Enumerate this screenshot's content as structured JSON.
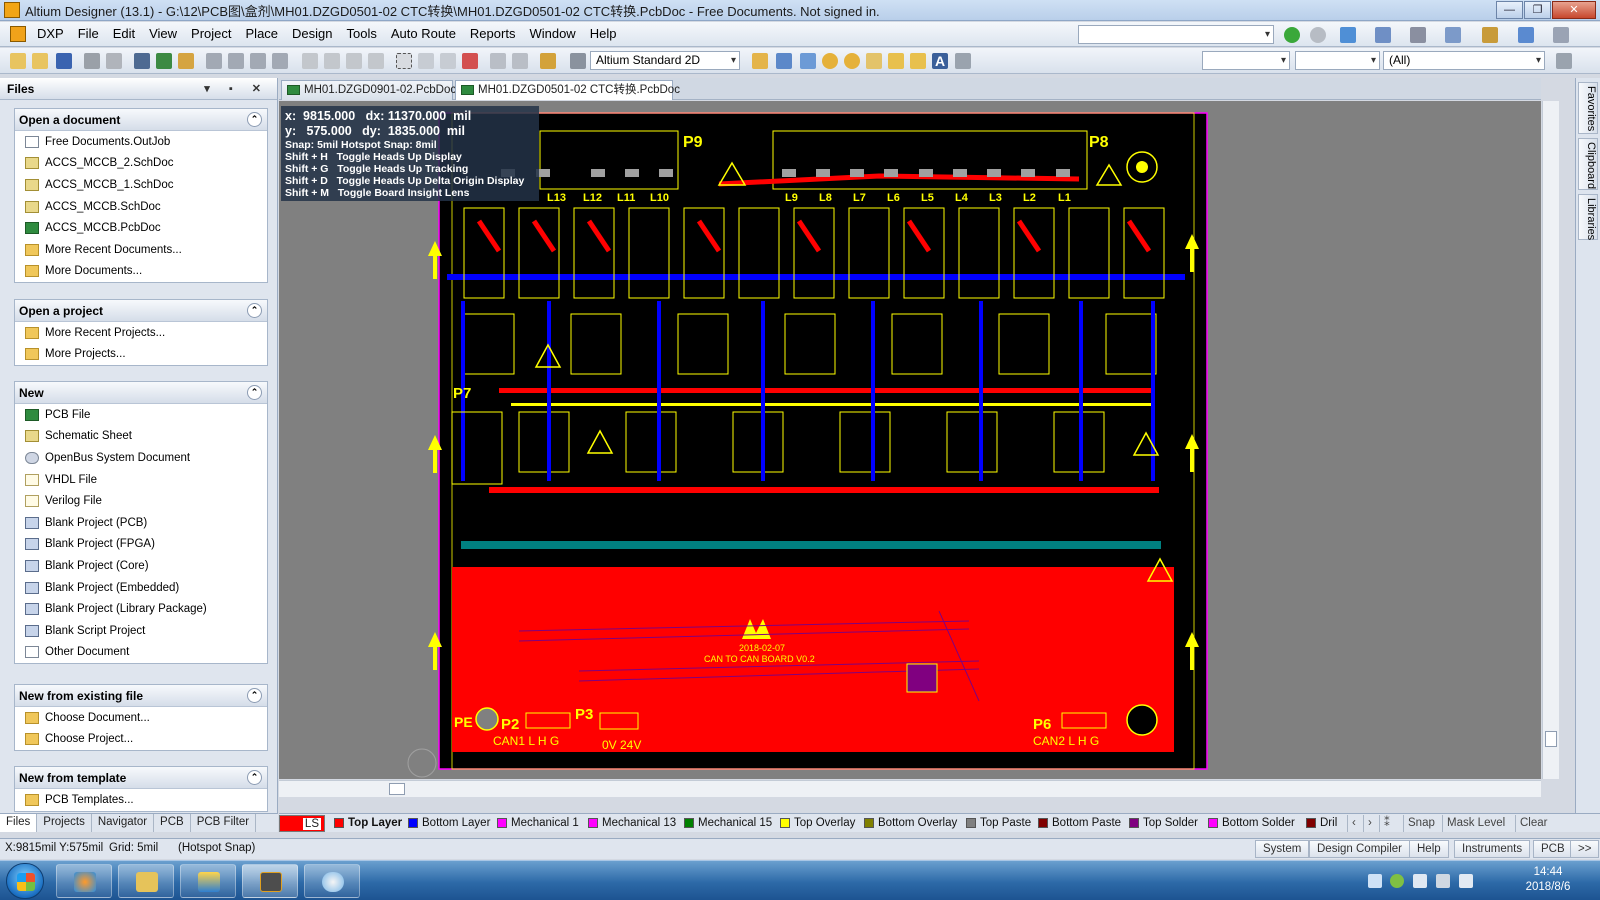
{
  "window": {
    "title": "Altium Designer (13.1) - G:\\12\\PCB图\\盒剂\\MH01.DZGD0501-02 CTC转换\\MH01.DZGD0501-02 CTC转换.PcbDoc - Free Documents. Not signed in.",
    "minimize": "0",
    "maximize": "1",
    "close": "r"
  },
  "menu": {
    "items": [
      "DXP",
      "File",
      "Edit",
      "View",
      "Project",
      "Place",
      "Design",
      "Tools",
      "Auto Route",
      "Reports",
      "Window",
      "Help"
    ]
  },
  "toolbar": {
    "view_mode": "Altium Standard 2D",
    "filter": "(All)"
  },
  "files_panel": {
    "title": "Files",
    "sections": [
      {
        "title": "Open a document",
        "items": [
          {
            "label": "Free Documents.OutJob",
            "icon": "doc"
          },
          {
            "label": "ACCS_MCCB_2.SchDoc",
            "icon": "sch"
          },
          {
            "label": "ACCS_MCCB_1.SchDoc",
            "icon": "sch"
          },
          {
            "label": "ACCS_MCCB.SchDoc",
            "icon": "sch"
          },
          {
            "label": "ACCS_MCCB.PcbDoc",
            "icon": "pcb"
          },
          {
            "label": "More Recent Documents...",
            "icon": "folder"
          },
          {
            "label": "More Documents...",
            "icon": "folder"
          }
        ]
      },
      {
        "title": "Open a project",
        "items": [
          {
            "label": "More Recent Projects...",
            "icon": "folder"
          },
          {
            "label": "More Projects...",
            "icon": "folder"
          }
        ]
      },
      {
        "title": "New",
        "items": [
          {
            "label": "PCB File",
            "icon": "pcb"
          },
          {
            "label": "Schematic Sheet",
            "icon": "sch"
          },
          {
            "label": "OpenBus System Document",
            "icon": "bus"
          },
          {
            "label": "VHDL File",
            "icon": "hdl"
          },
          {
            "label": "Verilog File",
            "icon": "hdl"
          },
          {
            "label": "Blank Project (PCB)",
            "icon": "prj"
          },
          {
            "label": "Blank Project (FPGA)",
            "icon": "prj"
          },
          {
            "label": "Blank Project (Core)",
            "icon": "prj"
          },
          {
            "label": "Blank Project (Embedded)",
            "icon": "prj"
          },
          {
            "label": "Blank Project (Library Package)",
            "icon": "prj"
          },
          {
            "label": "Blank Script Project",
            "icon": "prj"
          },
          {
            "label": "Other Document",
            "icon": "doc"
          }
        ]
      },
      {
        "title": "New from existing file",
        "items": [
          {
            "label": "Choose Document...",
            "icon": "folder"
          },
          {
            "label": "Choose Project...",
            "icon": "folder"
          }
        ]
      },
      {
        "title": "New from template",
        "items": [
          {
            "label": "PCB Templates...",
            "icon": "folder"
          }
        ]
      }
    ]
  },
  "panel_tabs": [
    "Files",
    "Projects",
    "Navigator",
    "PCB",
    "PCB Filter"
  ],
  "doc_tabs": [
    {
      "label": "MH01.DZGD0901-02.PcbDoc *",
      "active": false
    },
    {
      "label": "MH01.DZGD0501-02 CTC转换.PcbDoc",
      "active": true
    }
  ],
  "hud": {
    "line1": "x:  9815.000   dx: 11370.000  mil",
    "line2": "y:   575.000   dy:  1835.000  mil",
    "snap": "Snap: 5mil Hotspot Snap: 8mil",
    "hints": [
      "Shift + H   Toggle Heads Up Display",
      "Shift + G   Toggle Heads Up Tracking",
      "Shift + D   Toggle Heads Up Delta Origin Display",
      "Shift + M   Toggle Board Insight Lens"
    ]
  },
  "pcb": {
    "board_text": "2018-02-07",
    "board_name": "CAN TO CAN BOARD V0.2",
    "connectors": {
      "p9": "P9",
      "p8": "P8",
      "p7": "P7",
      "p2": "P2",
      "p3": "P3",
      "p6": "P6",
      "pe": "PE",
      "can1": "CAN1 L H G",
      "can2": "CAN2 L H G",
      "power": "0V 24V"
    },
    "l_labels": [
      "L13",
      "L12",
      "L11",
      "L10",
      "L9",
      "L8",
      "L7",
      "L6",
      "L5",
      "L4",
      "L3",
      "L2",
      "L1"
    ]
  },
  "right_tabs": [
    "Favorites",
    "Clipboard",
    "Libraries"
  ],
  "layers": [
    {
      "label": "LS",
      "color": "#ff0000"
    },
    {
      "label": "Top Layer",
      "color": "#ff0000",
      "active": true
    },
    {
      "label": "Bottom Layer",
      "color": "#0000ff"
    },
    {
      "label": "Mechanical 1",
      "color": "#ff00ff"
    },
    {
      "label": "Mechanical 13",
      "color": "#ff00ff"
    },
    {
      "label": "Mechanical 15",
      "color": "#008000"
    },
    {
      "label": "Top Overlay",
      "color": "#ffff00"
    },
    {
      "label": "Bottom Overlay",
      "color": "#808000"
    },
    {
      "label": "Top Paste",
      "color": "#808080"
    },
    {
      "label": "Bottom Paste",
      "color": "#800000"
    },
    {
      "label": "Top Solder",
      "color": "#800080"
    },
    {
      "label": "Bottom Solder",
      "color": "#ff00ff"
    },
    {
      "label": "Dril",
      "color": "#800000"
    }
  ],
  "layer_buttons": [
    "Snap",
    "Mask Level",
    "Clear"
  ],
  "status": {
    "coords": "X:9815mil Y:575mil",
    "grid": "Grid: 5mil",
    "snap": "(Hotspot Snap)",
    "buttons": [
      "System",
      "Design Compiler",
      "Help",
      "Instruments",
      "PCB",
      ">>"
    ]
  },
  "taskbar": {
    "time": "14:44",
    "date": "2018/8/6"
  }
}
